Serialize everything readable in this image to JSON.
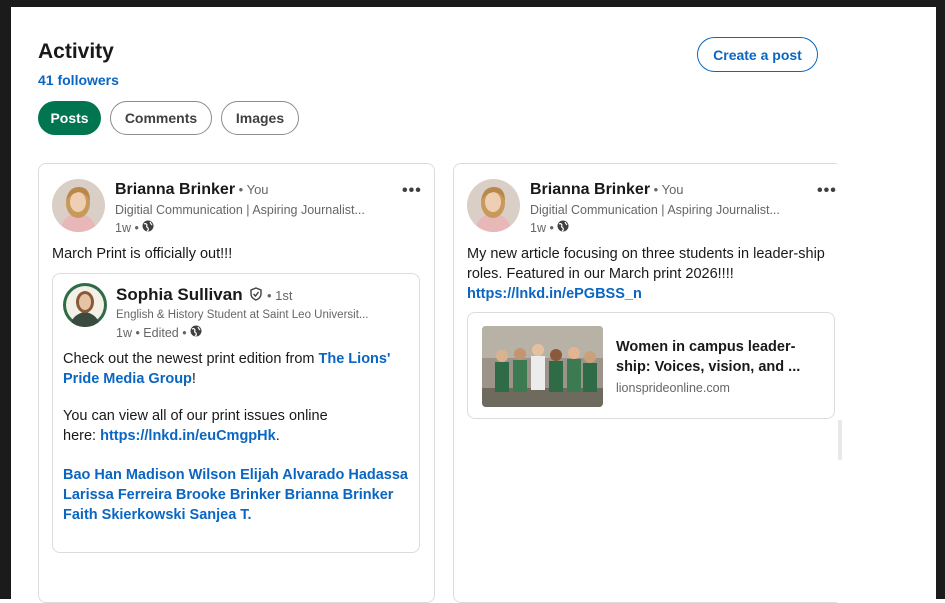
{
  "activity": {
    "title": "Activity",
    "followers": "41 followers",
    "create_post_label": "Create a post",
    "tabs": [
      {
        "label": "Posts",
        "active": true
      },
      {
        "label": "Comments",
        "active": false
      },
      {
        "label": "Images",
        "active": false
      }
    ]
  },
  "colors": {
    "brand_blue": "#0a66c2",
    "active_tab_green": "#01754f"
  },
  "posts": [
    {
      "author": "Brianna Brinker",
      "you_tag": " • You",
      "headline": "Digitial Communication | Aspiring Journalist...",
      "meta": "1w •",
      "more": "•••",
      "text": "March Print is officially out!!!",
      "shared": {
        "author": "Sophia Sullivan",
        "degree": " • 1st",
        "headline": "English & History Student at Saint Leo Universit...",
        "meta": "1w • Edited •",
        "line1_prefix": "Check out the newest print edition from ",
        "line1_link": "The Lions' Pride Media Group",
        "line1_suffix": "!",
        "line2_prefix": "You can view all of our print issues online here: ",
        "line2_link": "https://lnkd.in/euCmgpHk",
        "line2_suffix": ".",
        "tags": "Bao Han Madison Wilson Elijah Alvarado Hadassa Larissa Ferreira Brooke Brinker Brianna Brinker Faith Skierkowski Sanjea T."
      }
    },
    {
      "author": "Brianna Brinker",
      "you_tag": " • You",
      "headline": "Digitial Communication | Aspiring Journalist...",
      "meta": "1w •",
      "more": "•••",
      "text": "My new article focusing on three students in leader-ship roles. Featured in our March print 2026!!!!",
      "link": "https://lnkd.in/ePGBSS_n",
      "link_card": {
        "title": "Women in campus leader-ship: Voices, vision, and ...",
        "domain": "lionsprideonline.com"
      }
    }
  ]
}
